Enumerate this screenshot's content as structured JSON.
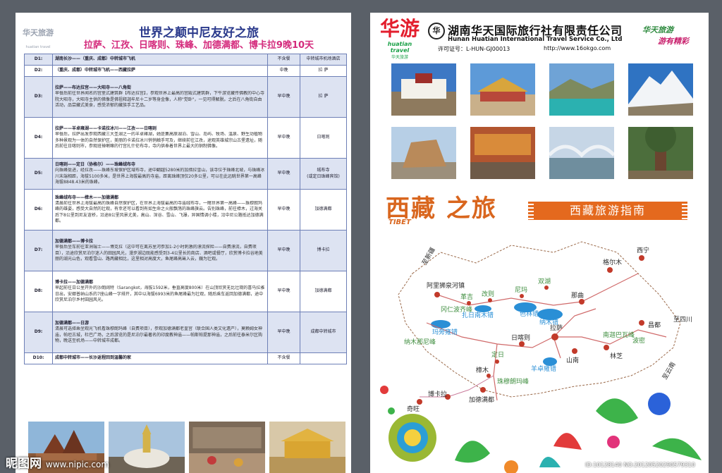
{
  "left": {
    "logo_text": "华天旅游",
    "logo_sub": "huatian travel",
    "title": "世界之颠中尼友好之旅",
    "subtitle": "拉萨、江孜、日喀则、珠峰、加德满都、博卡拉9晚10天",
    "rows": [
      {
        "day": "D1:",
        "title": "湖南长沙——（重庆、成都）中转城市飞机",
        "desc": "",
        "meal": "不含餐",
        "hotel": "中转城市机场酒店"
      },
      {
        "day": "D2:",
        "title": "（重庆、成都）中转城市飞机——西藏拉萨",
        "desc": "",
        "meal": "中晚",
        "hotel": "拉  萨"
      },
      {
        "day": "D3:",
        "title": "拉萨——布达拉宫——大昭寺——八角街",
        "desc": "早餐后前往世界闻名的宫堡式建筑群【布达拉宫】，参观世界上最高的宫殿式建筑群，下午游览藏传佛教的中心寺院大昭寺，大昭寺主供的佛像是佛祖释迦牟尼十二岁等身金像，人称\"觉卧\"，一见可得解脱。之后在八角街自由活动，品尝藏式美食，感受浓郁的藏族手工艺品。",
        "meal": "早中晚",
        "hotel": "拉  萨"
      },
      {
        "day": "D4:",
        "title": "拉萨——羊卓雍湖——卡诺拉冰川——江孜——日喀则",
        "desc": "早餐后，拉萨出发参观西藏三大圣湖之一的羊卓雍湖，她是集高原湖泊、雪山、岛屿、牧场、温泉、野生动植物多种景观为一体的自然保护区，美丽的卡诺拉冰川悄悄触手可及，继续前往江孜，途观英雄城宗山古堡遗址，随后前往日喀则市，参观班禅喇嘛的行宫扎什伦布寺，寺内供奉着世界上最大的铜制佛像。",
        "meal": "早中晚",
        "hotel": "日喀则"
      },
      {
        "day": "D5:",
        "title": "日喀则——定日（协格尔）——珠峰绒布寺",
        "desc": "向珠峰挺进，经拉孜——珠峰东坡保护区域布寺，途中翻越5280米的加措拉雪山，该寺位于珠峰北坡，与珠峰冰川末端相距，海拔5100多米，是世界上海拔最高的寺庙，距离珠峰顶仅20多公里，可以在此远眺世界第一高峰海拔8848.43米的珠峰。",
        "meal": "早中晚",
        "hotel": "绒布寺\n(或定日珠峰宾馆)"
      },
      {
        "day": "D6:",
        "title": "珠峰绒布寺——樟木——加德满都",
        "desc": "清晨前往世界上海拔最高的珠峰自然保护区，在世界上海拔最高的寺庙绒布寺，一睹世界第一高峰——珠穆朗玛峰的雄姿，感受大自然的壮观，有幸还可以看到有如生命之火般飘荡的珠峰旗云。告别珠峰，前往樟木，过海关后下8公里到尼友谊桥，沿途8公里风景尤美，高山、深谷、雪山、飞瀑，异国情调小楼，沿中尼公路抵达加德满都。",
        "meal": "早中晚",
        "hotel": "加德满都"
      },
      {
        "day": "D7:",
        "title": "加德满都——博卡拉",
        "desc": "早餐后坐车前往亚洲瑞士——博克拉（这中可在离苏里河参加1-2小时刺激的漂流探险——自费漂流，自费项目），沿途欣赏尼泊尔迷人的田园风光，漫步湖边既能感受到3-4公里长的商店、酒吧或餐厅，欣赏博卡拉谷地美丽的湖光山色，观看雪山、路两藏相比，这里相对高度大，鱼尾峰高耸入云，巍为壮观。",
        "meal": "早中晚",
        "hotel": "博卡拉"
      },
      {
        "day": "D8:",
        "title": "博卡拉——加德满都",
        "desc": "早起前往日公里开外的沙朗阔特（Sarangkot，海拔1592米，垂直高度800米）在山顶欣赏无比壮观的喜马拉雅日出，安娜普纳山系的7座山峰一字排开，其中以海拔6993米的鱼尾峰最为壮观，随后乘车返回加德满都，途中欣赏尼泊尔乡村田园风光。",
        "meal": "早中晚",
        "hotel": "加德满都"
      },
      {
        "day": "D9:",
        "title": "加德满都——日游",
        "desc": "清晨可选择乘坐观光飞机看珠穆朗玛峰（自费项目），参观加德满都老皇宫（联合国人类文化遗产），莫赖姆女神庙，帕坦古城，杜巴广场，之后游览的是尼泊尔最著名的印度教神庙——帕斯帕提那神庙，之后前往泰米尔区购物，晚送至机场——中转城市成都。",
        "meal": "早中晚",
        "hotel": "成都中转城市"
      },
      {
        "day": "D10:",
        "title": "成都中转城市——长沙返程回到温馨的家",
        "desc": "",
        "meal": "不含餐",
        "hotel": ""
      }
    ],
    "photos": [
      "nepal-temple",
      "stupa",
      "market",
      "golden-temple"
    ]
  },
  "right": {
    "logo_mark": "华游",
    "logo_en": "huatian travel",
    "logo_cn": "华天旅游",
    "company_cn": "湖南华天国际旅行社有限责任公司",
    "company_en": "Hunan Huatian International Travel Service Co., Ltd",
    "license": "许可证号：L-HUN-GJ00013",
    "website": "http://www.16okgo.com",
    "slogan_line1": "华天旅游",
    "slogan_line2": "游有精彩",
    "photos": [
      "potala",
      "jokhang",
      "yamdrok-lake",
      "everest",
      "stone-carving",
      "street",
      "bridge",
      "tree"
    ],
    "tibet_cn": "西藏  之旅",
    "tibet_en": "TIBET",
    "guide": "西藏旅游指南",
    "map_labels": {
      "xinjiang": "至新疆",
      "ali": "阿里狮泉河镇",
      "geji": "革吉",
      "gaize": "改则",
      "shuanghu": "双湖",
      "nima": "尼玛",
      "xianing": "西宁",
      "geermu": "格尔木",
      "nagqu": "那曲",
      "changdu": "昌都",
      "sichuan": "至四川",
      "yunnan": "至云南",
      "lhasa": "拉萨",
      "shannan": "山南",
      "linzhi": "林芝",
      "rikaze": "日喀则",
      "zhangmu": "樟木",
      "bokala": "博卡拉",
      "jiademan": "加德满都",
      "qiwang": "奇旺",
      "everest": "珠穆朗玛峰",
      "namco": "纳木错",
      "selin": "色林错",
      "zharinam": "扎日南木错",
      "yamdrok": "羊卓雍错",
      "mapam": "玛旁雍错",
      "naimu": "纳木那尼峰",
      "gangren": "冈仁波齐峰",
      "tingri": "定日",
      "nanjiabawa": "南迦巴瓦峰",
      "bomi": "波密"
    }
  }
}
